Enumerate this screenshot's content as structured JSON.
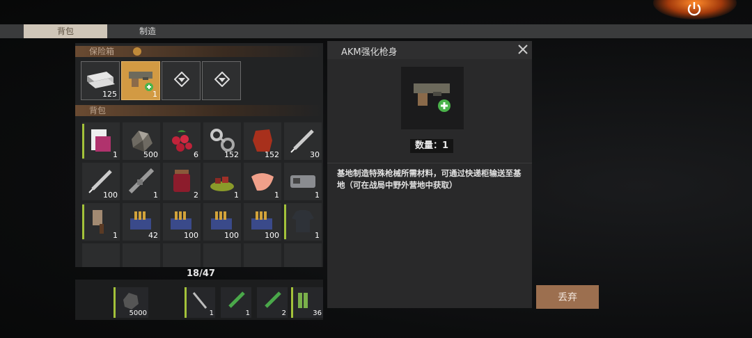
{
  "tabs": [
    "背包",
    "制造"
  ],
  "safe": {
    "header": "保险箱",
    "slots": [
      {
        "icon": "ingot-icon",
        "count": "125"
      },
      {
        "icon": "gun-part-icon",
        "count": "1"
      },
      {
        "icon": "locked-slot-icon",
        "count": ""
      },
      {
        "icon": "locked-slot-icon",
        "count": ""
      }
    ]
  },
  "backpack": {
    "header": "背包",
    "capacity": "18/47",
    "items": [
      {
        "icon": "document-icon",
        "count": "1"
      },
      {
        "icon": "ore-icon",
        "count": "500"
      },
      {
        "icon": "berries-icon",
        "count": "6"
      },
      {
        "icon": "gears-icon",
        "count": "152"
      },
      {
        "icon": "leather-icon",
        "count": "152"
      },
      {
        "icon": "syringe-icon",
        "count": "30"
      },
      {
        "icon": "syringe-icon",
        "count": "100"
      },
      {
        "icon": "rifle-icon",
        "count": "1"
      },
      {
        "icon": "jam-jar-icon",
        "count": "2"
      },
      {
        "icon": "meat-plate-icon",
        "count": "1"
      },
      {
        "icon": "raw-meat-icon",
        "count": "1"
      },
      {
        "icon": "device-icon",
        "count": "1"
      },
      {
        "icon": "cleaver-icon",
        "count": "1"
      },
      {
        "icon": "ammo-box-icon",
        "count": "42"
      },
      {
        "icon": "ammo-box-icon",
        "count": "100"
      },
      {
        "icon": "ammo-box-icon",
        "count": "100"
      },
      {
        "icon": "ammo-box-icon",
        "count": "100"
      },
      {
        "icon": "shirt-icon",
        "count": "1"
      }
    ]
  },
  "quickbar": [
    {
      "icon": "stone-icon",
      "count": "5000"
    },
    {
      "icon": "sword-icon",
      "count": "1"
    },
    {
      "icon": "injector-icon",
      "count": "1"
    },
    {
      "icon": "injector-icon",
      "count": "2"
    },
    {
      "icon": "bullets-icon",
      "count": "36"
    }
  ],
  "detail": {
    "title": "AKM强化枪身",
    "quantity": "数量：1",
    "description": "基地制造特殊枪械所需材料，可通过快递柜输送至基地（可在战局中野外营地中获取）",
    "discard_label": "丢弃",
    "icon": "gun-part-icon"
  },
  "colors": {
    "accent": "#d29a43",
    "discard": "#9c6f4f",
    "rarity_bar": "#a3c23a"
  }
}
